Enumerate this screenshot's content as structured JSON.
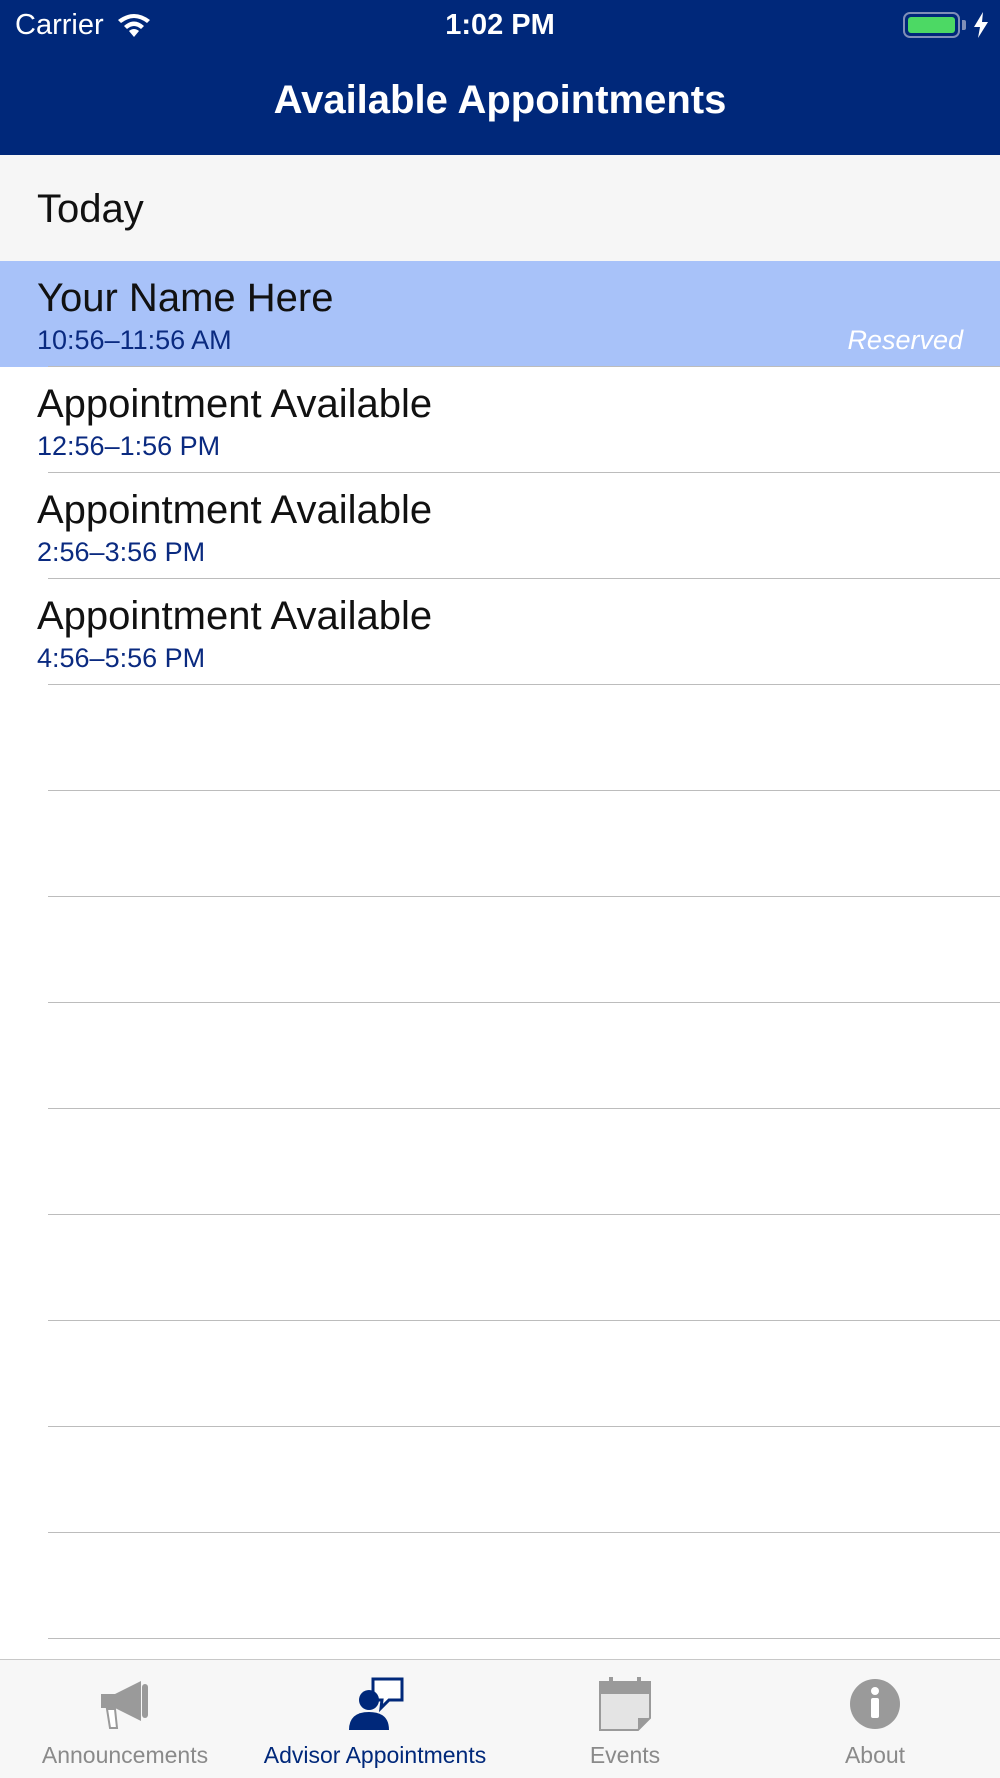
{
  "status_bar": {
    "carrier": "Carrier",
    "time": "1:02 PM",
    "battery_level": 1.0
  },
  "nav": {
    "title": "Available Appointments"
  },
  "section": {
    "title": "Today"
  },
  "appointments": [
    {
      "title": "Your Name Here",
      "time": "10:56–11:56 AM",
      "status": "Reserved"
    },
    {
      "title": "Appointment Available",
      "time": "12:56–1:56 PM",
      "status": ""
    },
    {
      "title": "Appointment Available",
      "time": "2:56–3:56 PM",
      "status": ""
    },
    {
      "title": "Appointment Available",
      "time": "4:56–5:56 PM",
      "status": ""
    }
  ],
  "tabs": [
    {
      "label": "Announcements",
      "icon": "megaphone-icon"
    },
    {
      "label": "Advisor Appointments",
      "icon": "advisor-chat-icon"
    },
    {
      "label": "Events",
      "icon": "calendar-icon"
    },
    {
      "label": "About",
      "icon": "info-icon"
    }
  ],
  "colors": {
    "header": "#00287a",
    "reserved_row": "#a8c2f9",
    "active_tab": "#00287a",
    "inactive_tab": "#8a8a8a"
  }
}
